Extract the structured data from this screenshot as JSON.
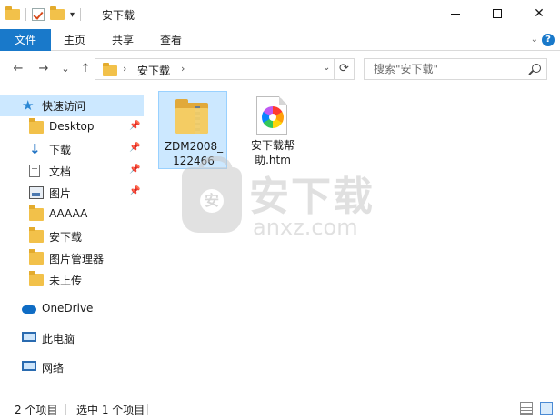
{
  "window": {
    "title": "安下载"
  },
  "ribbon": {
    "tabs": [
      "文件",
      "主页",
      "共享",
      "查看"
    ],
    "help_label": "?"
  },
  "nav": {
    "back": "←",
    "forward": "→",
    "recent": "⌄",
    "up": "↑",
    "breadcrumb": "安下载",
    "refresh": "⟳"
  },
  "search": {
    "placeholder": "搜索\"安下载\""
  },
  "sidebar": {
    "quick_access": "快速访问",
    "items": [
      {
        "label": "Desktop",
        "icon": "folder-icon",
        "pinned": true
      },
      {
        "label": "下载",
        "icon": "download-icon",
        "pinned": true
      },
      {
        "label": "文档",
        "icon": "document-icon",
        "pinned": true
      },
      {
        "label": "图片",
        "icon": "pictures-icon",
        "pinned": true
      },
      {
        "label": "AAAAA",
        "icon": "folder-icon",
        "pinned": false
      },
      {
        "label": "安下载",
        "icon": "folder-icon",
        "pinned": false
      },
      {
        "label": "图片管理器",
        "icon": "folder-icon",
        "pinned": false
      },
      {
        "label": "未上传",
        "icon": "folder-icon",
        "pinned": false
      }
    ],
    "onedrive": "OneDrive",
    "this_pc": "此电脑",
    "network": "网络"
  },
  "files": [
    {
      "name": "ZDM2008_\n122466",
      "line1": "ZDM2008_",
      "line2": "122466",
      "icon": "zip-folder-icon",
      "selected": true
    },
    {
      "name": "安下载帮助.htm",
      "line1": "安下载帮",
      "line2": "助.htm",
      "icon": "htm-file-icon",
      "selected": false
    }
  ],
  "watermark": {
    "cn": "安下载",
    "en": "anxz.com",
    "badge": "安"
  },
  "status": {
    "count": "2 个项目",
    "selected": "选中 1 个项目"
  }
}
